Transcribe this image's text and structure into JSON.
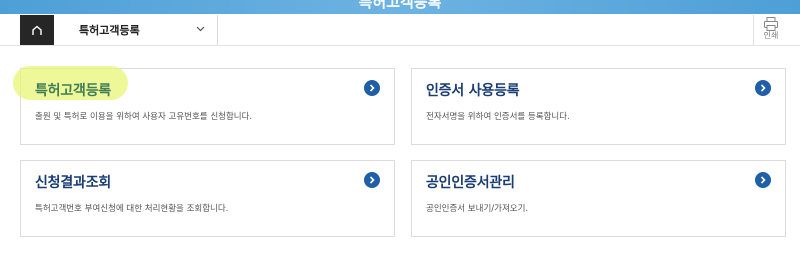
{
  "header": {
    "title": "특허고객등록"
  },
  "nav": {
    "home_icon": "home-icon",
    "dropdown_label": "특허고객등록",
    "dropdown_icon": "chevron-down-icon",
    "print_icon": "printer-icon",
    "print_label": "인쇄"
  },
  "cards": [
    {
      "title": "특허고객등록",
      "description": "출원 및 특허로 이용을 위하여 사용자 고유번호를 신청합니다.",
      "highlighted": true
    },
    {
      "title": "인증서 사용등록",
      "description": "전자서명을 위하여 인증서를 등록합니다."
    },
    {
      "title": "신청결과조회",
      "description": "특허고객번호 부여신청에 대한 처리현황을 조회합니다."
    },
    {
      "title": "공인인증서관리",
      "description": "공인인증서 보내기/가져오기."
    }
  ],
  "colors": {
    "accent": "#1f5fa8",
    "title": "#1a3d73",
    "highlight": "#e8f676",
    "header_band": "#4d9fd6",
    "home_button": "#262626"
  }
}
